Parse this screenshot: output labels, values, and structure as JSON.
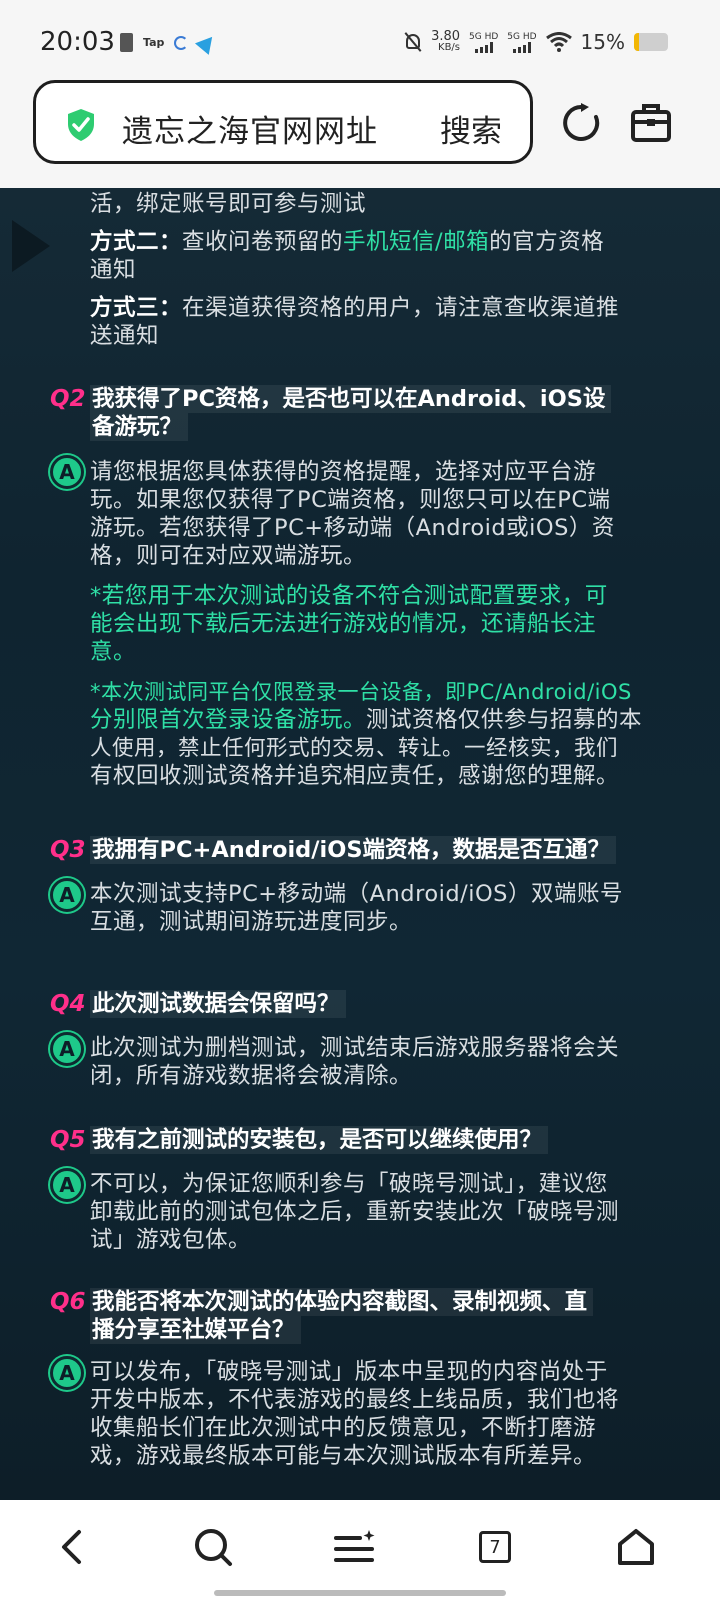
{
  "status_bar": {
    "time": "20:03",
    "app_label": "Tap",
    "net_speed_value": "3.80",
    "net_speed_unit": "KB/s",
    "sim1_label": "5G HD",
    "sim2_label": "5G HD",
    "battery_percent_text": "15%",
    "battery_level": 0.15,
    "icons": [
      "sim-card-icon",
      "loop-icon",
      "telegram-icon",
      "mute-icon",
      "signal-icon",
      "wifi-icon",
      "battery-icon"
    ]
  },
  "browser": {
    "url_text": "遗忘之海官网网址",
    "search_label": "搜索",
    "icons": [
      "shield-check-icon",
      "refresh-icon",
      "toolbox-icon"
    ],
    "shield_color": "#2ecc71"
  },
  "faq": {
    "top_lines": [
      "活，绑定账号即可参与测试"
    ],
    "method2_label": "方式二：",
    "method2_pre": "查收问卷预留的",
    "method2_highlight": "手机短信/邮箱",
    "method2_post": "的官方资格",
    "method2_line2": "通知",
    "method3_label": "方式三：",
    "method3_text": "在渠道获得资格的用户，请注意查收渠道推",
    "method3_line2": "送通知",
    "q2_tag": "Q2",
    "q2_line1": "我获得了PC资格，是否也可以在Android、iOS设",
    "q2_line2": "备游玩？",
    "a_label": "A",
    "a2_lines": [
      "请您根据您具体获得的资格提醒，选择对应平台游",
      "玩。如果您仅获得了PC端资格，则您只可以在PC端",
      "游玩。若您获得了PC+移动端（Android或iOS）资",
      "格，则可在对应双端游玩。"
    ],
    "a2_note1": [
      "*若您用于本次测试的设备不符合测试配置要求，可",
      "能会出现下载后无法进行游戏的情况，还请船长注",
      "意。"
    ],
    "a2_note2_line1": "*本次测试同平台仅限登录一台设备，即PC/Android/iOS",
    "a2_note2_line2_green": "分别限首次登录设备游玩。",
    "a2_note2_line2_rest": "测试资格仅供参与招募的本",
    "a2_note2_line3": "人使用，禁止任何形式的交易、转让。一经核实，我们",
    "a2_note2_line4": "有权回收测试资格并追究相应责任，感谢您的理解。",
    "q3_tag": "Q3",
    "q3_line1": "我拥有PC+Android/iOS端资格，数据是否互通？",
    "a3_lines": [
      "本次测试支持PC+移动端（Android/iOS）双端账号",
      "互通，测试期间游玩进度同步。"
    ],
    "q4_tag": "Q4",
    "q4_line1": "此次测试数据会保留吗？",
    "a4_lines": [
      "此次测试为删档测试，测试结束后游戏服务器将会关",
      "闭，所有游戏数据将会被清除。"
    ],
    "q5_tag": "Q5",
    "q5_line1": "我有之前测试的安装包，是否可以继续使用？",
    "a5_lines": [
      "不可以，为保证您顺利参与「破晓号测试」，建议您",
      "卸载此前的测试包体之后，重新安装此次「破晓号测",
      "试」游戏包体。"
    ],
    "q6_tag": "Q6",
    "q6_line1": "我能否将本次测试的体验内容截图、录制视频、直",
    "q6_line2": "播分享至社媒平台？",
    "a6_lines": [
      "可以发布，「破晓号测试」版本中呈现的内容尚处于",
      "开发中版本，不代表游戏的最终上线品质，我们也将",
      "收集船长们在此次测试中的反馈意见，不断打磨游",
      "戏，游戏最终版本可能与本次测试版本有所差异。"
    ],
    "accent_green": "#2fe0a6",
    "accent_pink": "#ff2f8a"
  },
  "bottom_nav": {
    "tab_count": "7",
    "icons": [
      "back-icon",
      "search-icon",
      "menu-icon",
      "tabs-icon",
      "home-icon"
    ]
  }
}
